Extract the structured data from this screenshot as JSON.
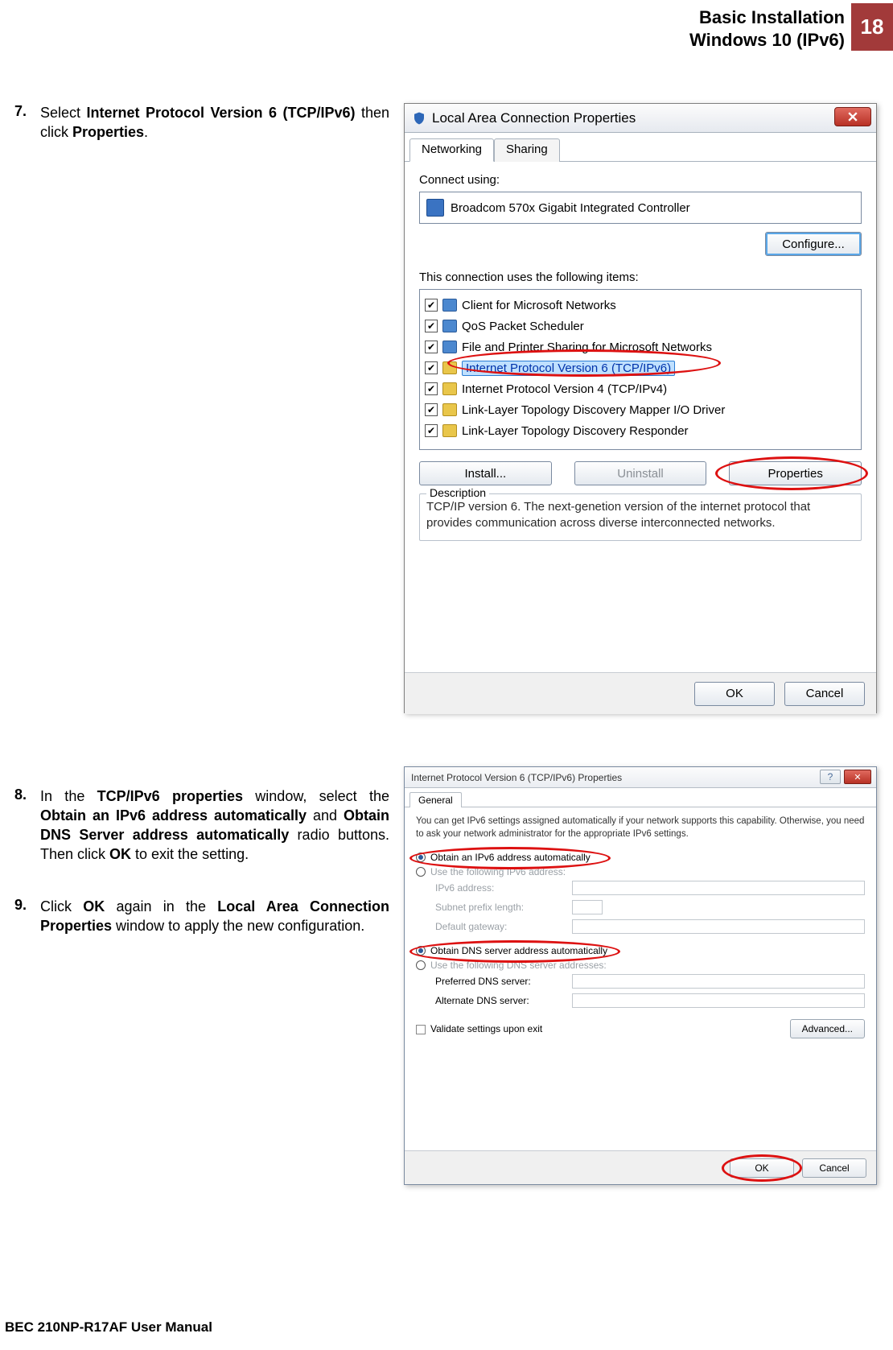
{
  "header": {
    "line1": "Basic Installation",
    "line2": "Windows 10 (IPv6)",
    "page": "18"
  },
  "steps": {
    "s7": {
      "num": "7.",
      "pre": "Select ",
      "b1": "Internet Protocol Version 6 (TCP/IPv6)",
      "mid": " then click ",
      "b2": "Properties",
      "post": "."
    },
    "s8": {
      "num": "8.",
      "t1": "In the ",
      "b1": "TCP/IPv6 properties",
      "t2": " window, select the ",
      "b2": "Obtain an IPv6 address automatically",
      "t3": " and ",
      "b3": "Obtain DNS Server address automatically",
      "t4": " radio buttons. Then click ",
      "b4": "OK",
      "t5": " to exit the setting."
    },
    "s9": {
      "num": "9.",
      "t1": "Click ",
      "b1": "OK",
      "t2": " again in the ",
      "b2": "Local Area Connection Properties",
      "t3": " window to apply the new configuration."
    }
  },
  "footer": "BEC 210NP-R17AF User Manual",
  "win1": {
    "title": "Local Area Connection Properties",
    "tabs": {
      "networking": "Networking",
      "sharing": "Sharing"
    },
    "connect_using": "Connect using:",
    "adapter": "Broadcom 570x Gigabit Integrated Controller",
    "configure": "Configure...",
    "uses_items": "This connection uses the following items:",
    "items": [
      "Client for Microsoft Networks",
      "QoS Packet Scheduler",
      "File and Printer Sharing for Microsoft Networks",
      "Internet Protocol Version 6  (TCP/IPv6)",
      "Internet Protocol Version 4  (TCP/IPv4)",
      "Link-Layer Topology Discovery Mapper I/O Driver",
      "Link-Layer Topology Discovery Responder"
    ],
    "install": "Install...",
    "uninstall": "Uninstall",
    "properties": "Properties",
    "desc_legend": "Description",
    "description": "TCP/IP version 6. The next-genetion version of the internet protocol that provides communication across diverse interconnected networks.",
    "ok": "OK",
    "cancel": "Cancel"
  },
  "win2": {
    "title": "Internet Protocol Version 6 (TCP/IPv6) Properties",
    "tab": "General",
    "intro": "You can get IPv6 settings assigned automatically if your network supports this capability. Otherwise, you need to ask your network administrator for the appropriate IPv6 settings.",
    "r1": "Obtain an IPv6 address automatically",
    "r2": "Use the following IPv6 address:",
    "l_addr": "IPv6 address:",
    "l_prefix": "Subnet prefix length:",
    "l_gw": "Default gateway:",
    "r3": "Obtain DNS server address automatically",
    "r4": "Use the following DNS server addresses:",
    "l_pdns": "Preferred DNS server:",
    "l_adns": "Alternate DNS server:",
    "validate": "Validate settings upon exit",
    "advanced": "Advanced...",
    "ok": "OK",
    "cancel": "Cancel"
  }
}
